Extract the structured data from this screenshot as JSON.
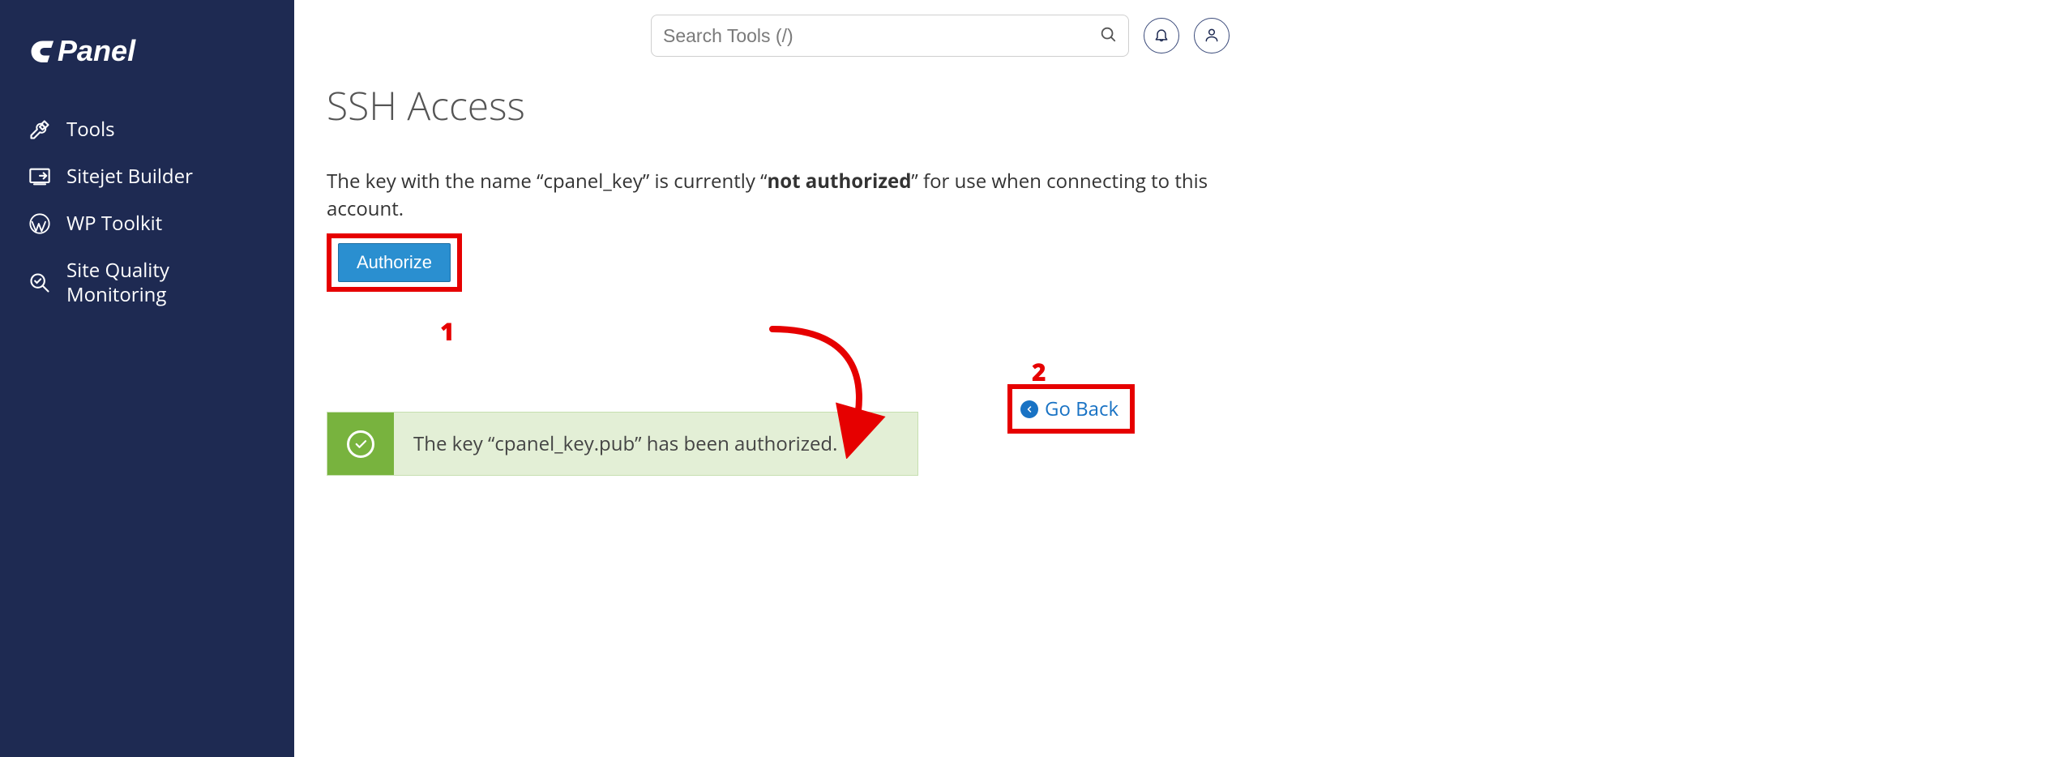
{
  "brand": "cPanel",
  "sidebar": {
    "items": [
      {
        "label": "Tools",
        "icon": "tools-icon"
      },
      {
        "label": "Sitejet Builder",
        "icon": "sitejet-icon"
      },
      {
        "label": "WP Toolkit",
        "icon": "wordpress-icon"
      },
      {
        "label": "Site Quality Monitoring",
        "icon": "magnifier-icon"
      }
    ]
  },
  "header": {
    "search_placeholder": "Search Tools (/)"
  },
  "page": {
    "title": "SSH Access",
    "status_prefix": "The key with the name “",
    "key_name": "cpanel_key",
    "status_mid": "” is currently “",
    "status_bold": "not authorized",
    "status_suffix": "” for use when connecting to this account.",
    "authorize_label": "Authorize",
    "go_back_label": "Go Back",
    "success_message": "The key “cpanel_key.pub” has been authorized."
  },
  "annotations": {
    "step1": "1",
    "step2": "2"
  },
  "colors": {
    "sidebar_bg": "#1e2a52",
    "accent": "#2a8fd0",
    "highlight": "#e60000",
    "success": "#78b33e",
    "link": "#1872c4"
  }
}
